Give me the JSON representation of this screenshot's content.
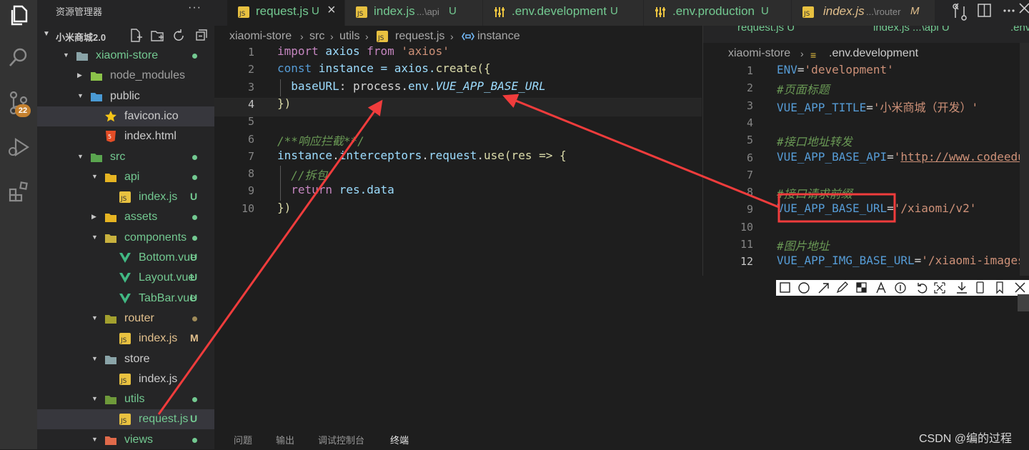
{
  "explorer": {
    "title": "资源管理器",
    "more": "···",
    "project_name": "小米商城2.0",
    "tree": [
      {
        "label": "xiaomi-store",
        "status": "",
        "dot": "#73c991",
        "color": "green"
      },
      {
        "label": "node_modules",
        "status": "",
        "dot": "",
        "color": "dim"
      },
      {
        "label": "public",
        "status": "",
        "dot": "",
        "color": "normal"
      },
      {
        "label": "favicon.ico",
        "status": "",
        "dot": "",
        "color": "normal"
      },
      {
        "label": "index.html",
        "status": "",
        "dot": "",
        "color": "normal"
      },
      {
        "label": "src",
        "status": "",
        "dot": "#73c991",
        "color": "green"
      },
      {
        "label": "api",
        "status": "",
        "dot": "#73c991",
        "color": "green"
      },
      {
        "label": "index.js",
        "status": "U",
        "dot": "",
        "color": "green"
      },
      {
        "label": "assets",
        "status": "",
        "dot": "#73c991",
        "color": "green"
      },
      {
        "label": "components",
        "status": "",
        "dot": "#73c991",
        "color": "green"
      },
      {
        "label": "Bottom.vue",
        "status": "U",
        "dot": "",
        "color": "green"
      },
      {
        "label": "Layout.vue",
        "status": "U",
        "dot": "",
        "color": "green"
      },
      {
        "label": "TabBar.vue",
        "status": "U",
        "dot": "",
        "color": "green"
      },
      {
        "label": "router",
        "status": "",
        "dot": "#a08b59",
        "color": "amber"
      },
      {
        "label": "index.js",
        "status": "M",
        "dot": "",
        "color": "amber"
      },
      {
        "label": "store",
        "status": "",
        "dot": "",
        "color": "normal"
      },
      {
        "label": "index.js",
        "status": "",
        "dot": "",
        "color": "normal"
      },
      {
        "label": "utils",
        "status": "",
        "dot": "#73c991",
        "color": "green"
      },
      {
        "label": "request.js",
        "status": "U",
        "dot": "",
        "color": "green"
      },
      {
        "label": "views",
        "status": "",
        "dot": "#73c991",
        "color": "green"
      }
    ]
  },
  "activity": {
    "scm_badge": "22"
  },
  "tabs": [
    {
      "name": "request.js",
      "desc": "",
      "status": "U",
      "close": "×"
    },
    {
      "name": "index.js",
      "desc": "...\\api",
      "status": "U"
    },
    {
      "name": ".env.development",
      "desc": "",
      "status": "U"
    },
    {
      "name": ".env.production",
      "desc": "",
      "status": "U"
    },
    {
      "name": "index.js",
      "desc": "...\\router",
      "status": "M"
    }
  ],
  "breadcrumb": [
    "xiaomi-store",
    "src",
    "utils",
    "request.js",
    "instance"
  ],
  "editor": {
    "line_numbers": [
      "1",
      "2",
      "3",
      "4",
      "5",
      "6",
      "7",
      "8",
      "9",
      "10"
    ],
    "lines": [
      [
        {
          "t": "import",
          "c": "kw"
        },
        {
          "t": " axios ",
          "c": "var"
        },
        {
          "t": "from",
          "c": "kw"
        },
        {
          "t": " 'axios'",
          "c": "str"
        }
      ],
      [
        {
          "t": "const",
          "c": "blu"
        },
        {
          "t": " instance = axios.",
          "c": "var"
        },
        {
          "t": "create",
          "c": "fn"
        },
        {
          "t": "({",
          "c": "fn"
        }
      ],
      [
        {
          "t": "  baseURL",
          "c": "var"
        },
        {
          "t": ": process.",
          "c": ""
        },
        {
          "t": "env",
          "c": "var"
        },
        {
          "t": ".",
          "c": ""
        },
        {
          "t": "VUE_APP_BASE_URL",
          "c": "var it"
        }
      ],
      [
        {
          "t": "})",
          "c": "fn"
        }
      ],
      [],
      [
        {
          "t": "/**响应拦截**/",
          "c": "cm"
        }
      ],
      [
        {
          "t": "instance",
          "c": "var"
        },
        {
          "t": ".",
          "c": ""
        },
        {
          "t": "interceptors",
          "c": "var"
        },
        {
          "t": ".",
          "c": ""
        },
        {
          "t": "request",
          "c": "var"
        },
        {
          "t": ".",
          "c": ""
        },
        {
          "t": "use",
          "c": "fn"
        },
        {
          "t": "(res => {",
          "c": "fn"
        }
      ],
      [
        {
          "t": "  //拆包",
          "c": "cm"
        }
      ],
      [
        {
          "t": "  return",
          "c": "kw"
        },
        {
          "t": " res.",
          "c": "var"
        },
        {
          "t": "data",
          "c": "var"
        }
      ],
      [
        {
          "t": "})",
          "c": "fn"
        }
      ]
    ]
  },
  "win2": {
    "tabs": [
      "request.js U",
      "index.js ...\\api U",
      ".env"
    ],
    "breadcrumb": [
      "xiaomi-store",
      ".env.development"
    ],
    "line_numbers": [
      "1",
      "2",
      "3",
      "4",
      "5",
      "6",
      "7",
      "8",
      "9",
      "10",
      "11",
      "12"
    ],
    "lines": [
      {
        "key": "ENV",
        "eq": "=",
        "val": "'development'",
        "type": "kv"
      },
      {
        "text": "#页面标题",
        "type": "comment"
      },
      {
        "key": "VUE_APP_TITLE",
        "eq": "=",
        "val": "'小米商城（开发）'",
        "type": "kv"
      },
      {
        "type": "empty"
      },
      {
        "text": "#接口地址转发",
        "type": "comment"
      },
      {
        "key": "VUE_APP_BASE_API",
        "eq": "=",
        "val": "'",
        "link": "http://www.codeedu",
        "type": "kvlink"
      },
      {
        "type": "empty"
      },
      {
        "text": "#接口请求前缀",
        "type": "comment"
      },
      {
        "key": "VUE_APP_BASE_URL",
        "eq": "=",
        "val": "'/xiaomi/v2'",
        "type": "kv"
      },
      {
        "type": "empty"
      },
      {
        "text": "#图片地址",
        "type": "comment"
      },
      {
        "key": "VUE_APP_IMG_BASE_URL",
        "eq": "=",
        "val": "'/xiaomi-images",
        "type": "kv"
      }
    ]
  },
  "panel": {
    "tabs": [
      "问题",
      "输出",
      "调试控制台",
      "终端"
    ]
  },
  "watermark": "CSDN @编的过程",
  "colors": {
    "accent_green": "#73c991",
    "modified": "#e2c08d",
    "annotation_red": "#f03c3c"
  }
}
